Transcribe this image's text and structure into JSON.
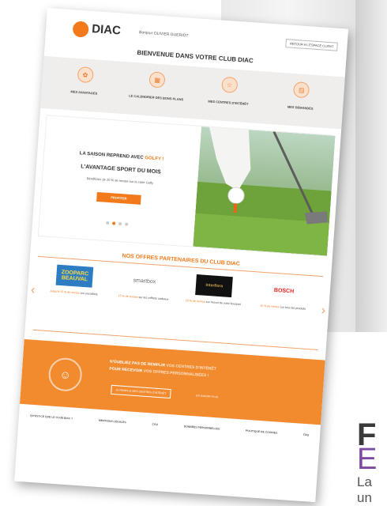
{
  "header": {
    "logo": "DIAC",
    "welcome": "Bonjour OLIVIER GUERIOT",
    "my_account": "RETOUR A L'ESPACE CLIENT",
    "title": "BIENVENUE DANS VOTRE CLUB DIAC"
  },
  "nav": [
    {
      "label": "MES AVANTAGES",
      "icon": "gift-icon"
    },
    {
      "label": "LE CALENDRIER DES BONS PLANS",
      "icon": "calendar-icon"
    },
    {
      "label": "MES CENTRES D'INTÉRÊT",
      "icon": "star-icon"
    },
    {
      "label": "MES DEMANDES",
      "icon": "document-icon"
    }
  ],
  "hero": {
    "line1_prefix": "LA SAISON REPREND AVEC",
    "line1_highlight": "GOLFY !",
    "line2": "L'AVANTAGE SPORT DU MOIS",
    "line3": "Bénéficiez de 20 % de remise sur la carte Golfy",
    "button": "PROFITER"
  },
  "partners_section": {
    "title": "NOS OFFRES PARTENAIRES DU CLUB DIAC",
    "items": [
      {
        "logo": "ZOOPARC BEAUVAL",
        "offer": "Jusqu'à 15 % de remise",
        "detail": "sur vos billets"
      },
      {
        "logo": "smartbox",
        "offer": "15 % de remise",
        "detail": "sur les coffrets cadeaux"
      },
      {
        "logo": "Interflora",
        "offer": "20 % de remise",
        "detail": "sur l'envoi de votre bouquet"
      },
      {
        "logo": "BOSCH",
        "offer": "15 % de remise",
        "detail": "sur tous les produits"
      }
    ]
  },
  "band": {
    "line1_prefix": "N'OUBLIEZ PAS DE REMPLIR",
    "line1_highlight": "VOS CENTRES D'INTÉRÊT",
    "line2_prefix": "POUR RECEVOIR",
    "line2_highlight": "VOS OFFRES PERSONNALISÉES !",
    "button": "JE REMPLIS MES CENTRES D'INTÉRÊT",
    "link": "EN SAVOIR PLUS"
  },
  "footer": [
    "QU'EST-CE QUE LE CLUB DIAC ?",
    "MENTIONS LÉGALES",
    "CGU",
    "DONNÉES PERSONNELLES",
    "POLITIQUE DE COOKIES",
    "FAQ"
  ],
  "side": {
    "title_letter": "F",
    "subtitle_letter": "E",
    "body_line1": "La",
    "body_line2": "un"
  },
  "colors": {
    "accent": "#f27a1a",
    "band": "#f28a2e",
    "purple": "#7d4aa1"
  }
}
